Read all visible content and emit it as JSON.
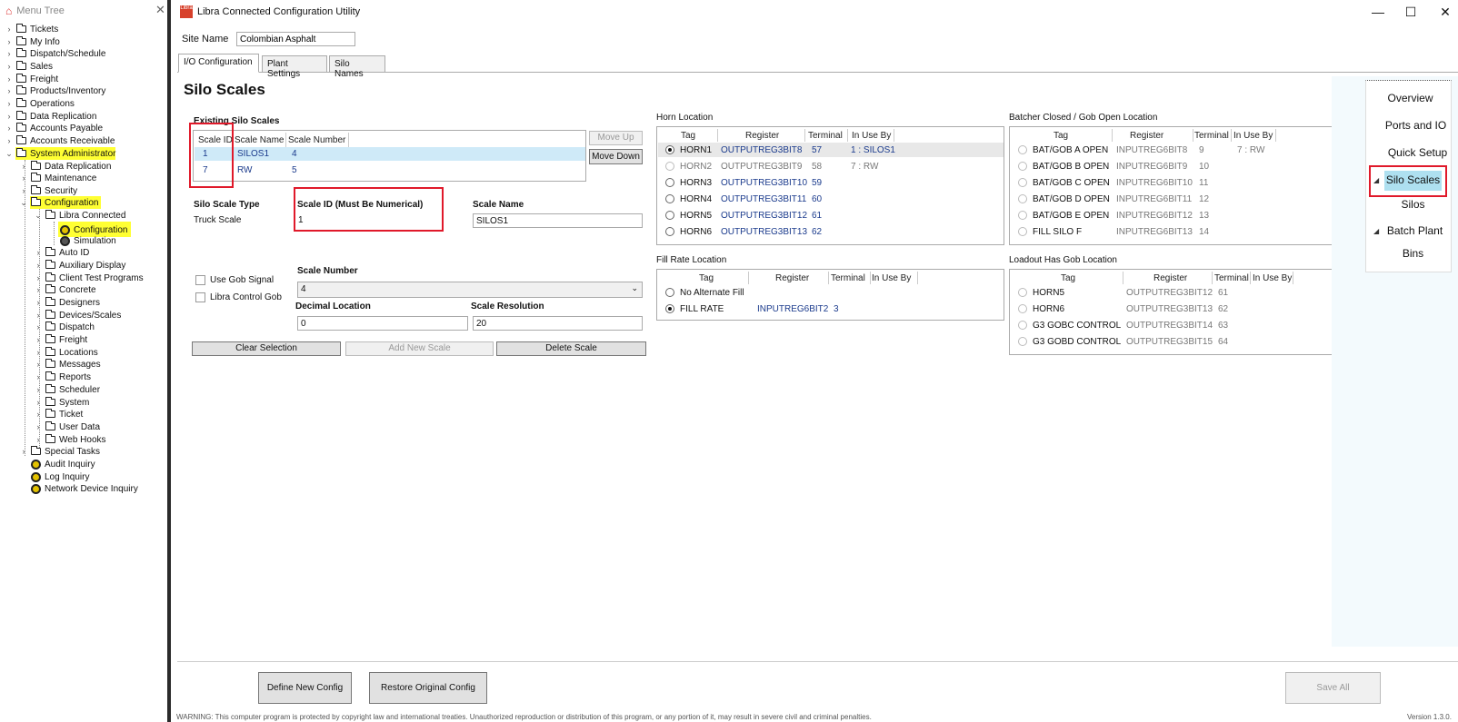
{
  "menu": {
    "title": "Menu Tree",
    "items": [
      {
        "label": "Tickets"
      },
      {
        "label": "My Info"
      },
      {
        "label": "Dispatch/Schedule"
      },
      {
        "label": "Sales"
      },
      {
        "label": "Freight"
      },
      {
        "label": "Products/Inventory"
      },
      {
        "label": "Operations"
      },
      {
        "label": "Data Replication"
      },
      {
        "label": "Accounts Payable"
      },
      {
        "label": "Accounts Receivable"
      },
      {
        "label": "System Administrator"
      },
      {
        "label": "Data Replication"
      },
      {
        "label": "Maintenance"
      },
      {
        "label": "Security"
      },
      {
        "label": "Configuration"
      },
      {
        "label": "Libra Connected"
      },
      {
        "label": "Configuration"
      },
      {
        "label": "Simulation"
      },
      {
        "label": "Auto ID"
      },
      {
        "label": "Auxiliary Display"
      },
      {
        "label": "Client Test Programs"
      },
      {
        "label": "Concrete"
      },
      {
        "label": "Designers"
      },
      {
        "label": "Devices/Scales"
      },
      {
        "label": "Dispatch"
      },
      {
        "label": "Freight"
      },
      {
        "label": "Locations"
      },
      {
        "label": "Messages"
      },
      {
        "label": "Reports"
      },
      {
        "label": "Scheduler"
      },
      {
        "label": "System"
      },
      {
        "label": "Ticket"
      },
      {
        "label": "User Data"
      },
      {
        "label": "Web Hooks"
      },
      {
        "label": "Special Tasks"
      },
      {
        "label": "Audit Inquiry"
      },
      {
        "label": "Log Inquiry"
      },
      {
        "label": "Network Device Inquiry"
      }
    ]
  },
  "window": {
    "title": "Libra Connected Configuration Utility",
    "icon_text": "Libra",
    "minimize": "—",
    "maximize": "☐",
    "close": "✕"
  },
  "site": {
    "label": "Site Name",
    "value": "Colombian Asphalt"
  },
  "tabs": [
    {
      "label": "I/O Configuration"
    },
    {
      "label": "Plant Settings"
    },
    {
      "label": "Silo Names"
    }
  ],
  "page_title": "Silo Scales",
  "existing": {
    "title": "Existing Silo Scales",
    "headers": [
      "Scale ID",
      "Scale Name",
      "Scale Number"
    ],
    "rows": [
      [
        "1",
        "SILOS1",
        "4"
      ],
      [
        "7",
        "RW",
        "5"
      ]
    ],
    "move_up": "Move Up",
    "move_down": "Move Down"
  },
  "form": {
    "type_label": "Silo Scale Type",
    "type_value": "Truck Scale",
    "id_label": "Scale ID (Must Be Numerical)",
    "id_value": "1",
    "name_label": "Scale Name",
    "name_value": "SILOS1",
    "use_gob": "Use Gob Signal",
    "libra_gob": "Libra Control Gob",
    "number_label": "Scale Number",
    "number_value": "4",
    "decimal_label": "Decimal Location",
    "decimal_value": "0",
    "resolution_label": "Scale Resolution",
    "resolution_value": "20",
    "clear": "Clear Selection",
    "add": "Add New Scale",
    "delete": "Delete Scale"
  },
  "horn": {
    "title": "Horn Location",
    "headers": [
      "Tag",
      "Register",
      "Terminal",
      "In Use By"
    ],
    "rows": [
      {
        "tag": "HORN1",
        "register": "OUTPUTREG3BIT8",
        "terminal": "57",
        "use": "1 : SILOS1",
        "checked": true
      },
      {
        "tag": "HORN2",
        "register": "OUTPUTREG3BIT9",
        "terminal": "58",
        "use": "7 : RW",
        "checked": false
      },
      {
        "tag": "HORN3",
        "register": "OUTPUTREG3BIT10",
        "terminal": "59",
        "use": "",
        "checked": false
      },
      {
        "tag": "HORN4",
        "register": "OUTPUTREG3BIT11",
        "terminal": "60",
        "use": "",
        "checked": false
      },
      {
        "tag": "HORN5",
        "register": "OUTPUTREG3BIT12",
        "terminal": "61",
        "use": "",
        "checked": false
      },
      {
        "tag": "HORN6",
        "register": "OUTPUTREG3BIT13",
        "terminal": "62",
        "use": "",
        "checked": false
      }
    ]
  },
  "batcher": {
    "title": "Batcher Closed / Gob Open Location",
    "headers": [
      "Tag",
      "Register",
      "Terminal",
      "In Use By"
    ],
    "rows": [
      {
        "tag": "BAT/GOB A OPEN",
        "register": "INPUTREG6BIT8",
        "terminal": "9",
        "use": "7 : RW"
      },
      {
        "tag": "BAT/GOB B OPEN",
        "register": "INPUTREG6BIT9",
        "terminal": "10",
        "use": ""
      },
      {
        "tag": "BAT/GOB C OPEN",
        "register": "INPUTREG6BIT10",
        "terminal": "11",
        "use": ""
      },
      {
        "tag": "BAT/GOB D OPEN",
        "register": "INPUTREG6BIT11",
        "terminal": "12",
        "use": ""
      },
      {
        "tag": "BAT/GOB E OPEN",
        "register": "INPUTREG6BIT12",
        "terminal": "13",
        "use": ""
      },
      {
        "tag": "FILL SILO F",
        "register": "INPUTREG6BIT13",
        "terminal": "14",
        "use": ""
      }
    ]
  },
  "fill": {
    "title": "Fill Rate Location",
    "headers": [
      "Tag",
      "Register",
      "Terminal",
      "In Use By"
    ],
    "rows": [
      {
        "tag": "No Alternate Fill",
        "register": "",
        "terminal": "",
        "checked": false
      },
      {
        "tag": "FILL RATE",
        "register": "INPUTREG6BIT2",
        "terminal": "3",
        "checked": true
      }
    ]
  },
  "loadout": {
    "title": "Loadout Has Gob Location",
    "headers": [
      "Tag",
      "Register",
      "Terminal",
      "In Use By"
    ],
    "rows": [
      {
        "tag": "HORN5",
        "register": "OUTPUTREG3BIT12",
        "terminal": "61"
      },
      {
        "tag": "HORN6",
        "register": "OUTPUTREG3BIT13",
        "terminal": "62"
      },
      {
        "tag": "G3 GOBC CONTROL",
        "register": "OUTPUTREG3BIT14",
        "terminal": "63"
      },
      {
        "tag": "G3 GOBD CONTROL",
        "register": "OUTPUTREG3BIT15",
        "terminal": "64"
      }
    ]
  },
  "nav": {
    "items": [
      {
        "label": "Overview"
      },
      {
        "label": "Ports and IO"
      },
      {
        "label": "Quick Setup"
      },
      {
        "label": "Silo Scales"
      },
      {
        "label": "Silos"
      },
      {
        "label": "Batch Plant"
      },
      {
        "label": "Bins"
      }
    ]
  },
  "footer": {
    "define": "Define New Config",
    "restore": "Restore Original Config",
    "save": "Save All",
    "warning": "WARNING: This computer program is protected by copyright law and international treaties. Unauthorized reproduction or distribution of this program, or any portion of it, may result in severe civil and criminal penalties.",
    "version": "Version 1.3.0."
  },
  "colors": {
    "highlight": "#ffff33",
    "annotation_red": "#e0192a",
    "selection_blue": "#cfeaf8",
    "nav_selected": "#aee0f0"
  }
}
